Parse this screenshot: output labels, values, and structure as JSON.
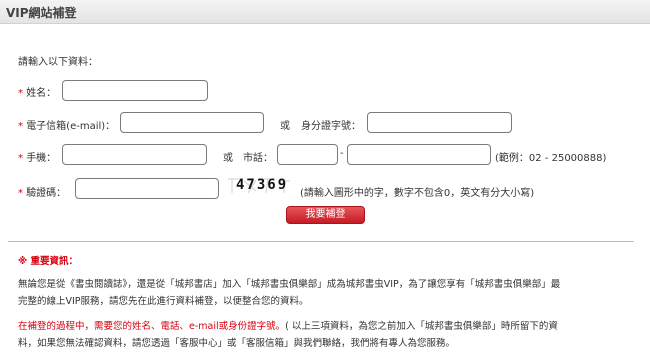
{
  "header": {
    "title": "VIP網站補登"
  },
  "form": {
    "intro": "請輸入以下資料：",
    "star": "*",
    "name_label": "姓名：",
    "email_label": "電子信箱(e-mail)：",
    "or1": "或",
    "id_label": "身分證字號：",
    "mobile_label": "手機：",
    "or2": "或",
    "phone_label": "市話：",
    "phone_dash": "-",
    "phone_example": "(範例：02 - 25000888)",
    "captcha_label": "驗證碼：",
    "captcha_code": "47369",
    "captcha_hint": "(請輸入圖形中的字，數字不包含0，英文有分大小寫)",
    "submit_label": "我要補登",
    "name_value": "",
    "email_value": "",
    "id_value": "",
    "mobile_value": "",
    "phone_area_value": "",
    "phone_number_value": "",
    "captcha_value": ""
  },
  "notice": {
    "title": "※ 重要資訊：",
    "p1_line1": "無論您是從《書虫閱讀誌》，還是從「城邦書店」加入「城邦書虫俱樂部」成為城邦書虫VIP，為了讓您享有「城邦書虫俱樂部」最",
    "p1_line2": "完整的線上VIP服務，請您先在此進行資料補登，以便整合您的資料。",
    "p2_red": "在補登的過程中，需要您的姓名、電話、e-mail或身份證字號。",
    "p2_line1_rest": "( 以上三項資料，為您之前加入「城邦書虫俱樂部」時所留下的資",
    "p2_line2": "料，如果您無法確認資料，請您透過「客服中心」或「客服信箱」與我們聯絡，我們將有專人為您服務。"
  }
}
